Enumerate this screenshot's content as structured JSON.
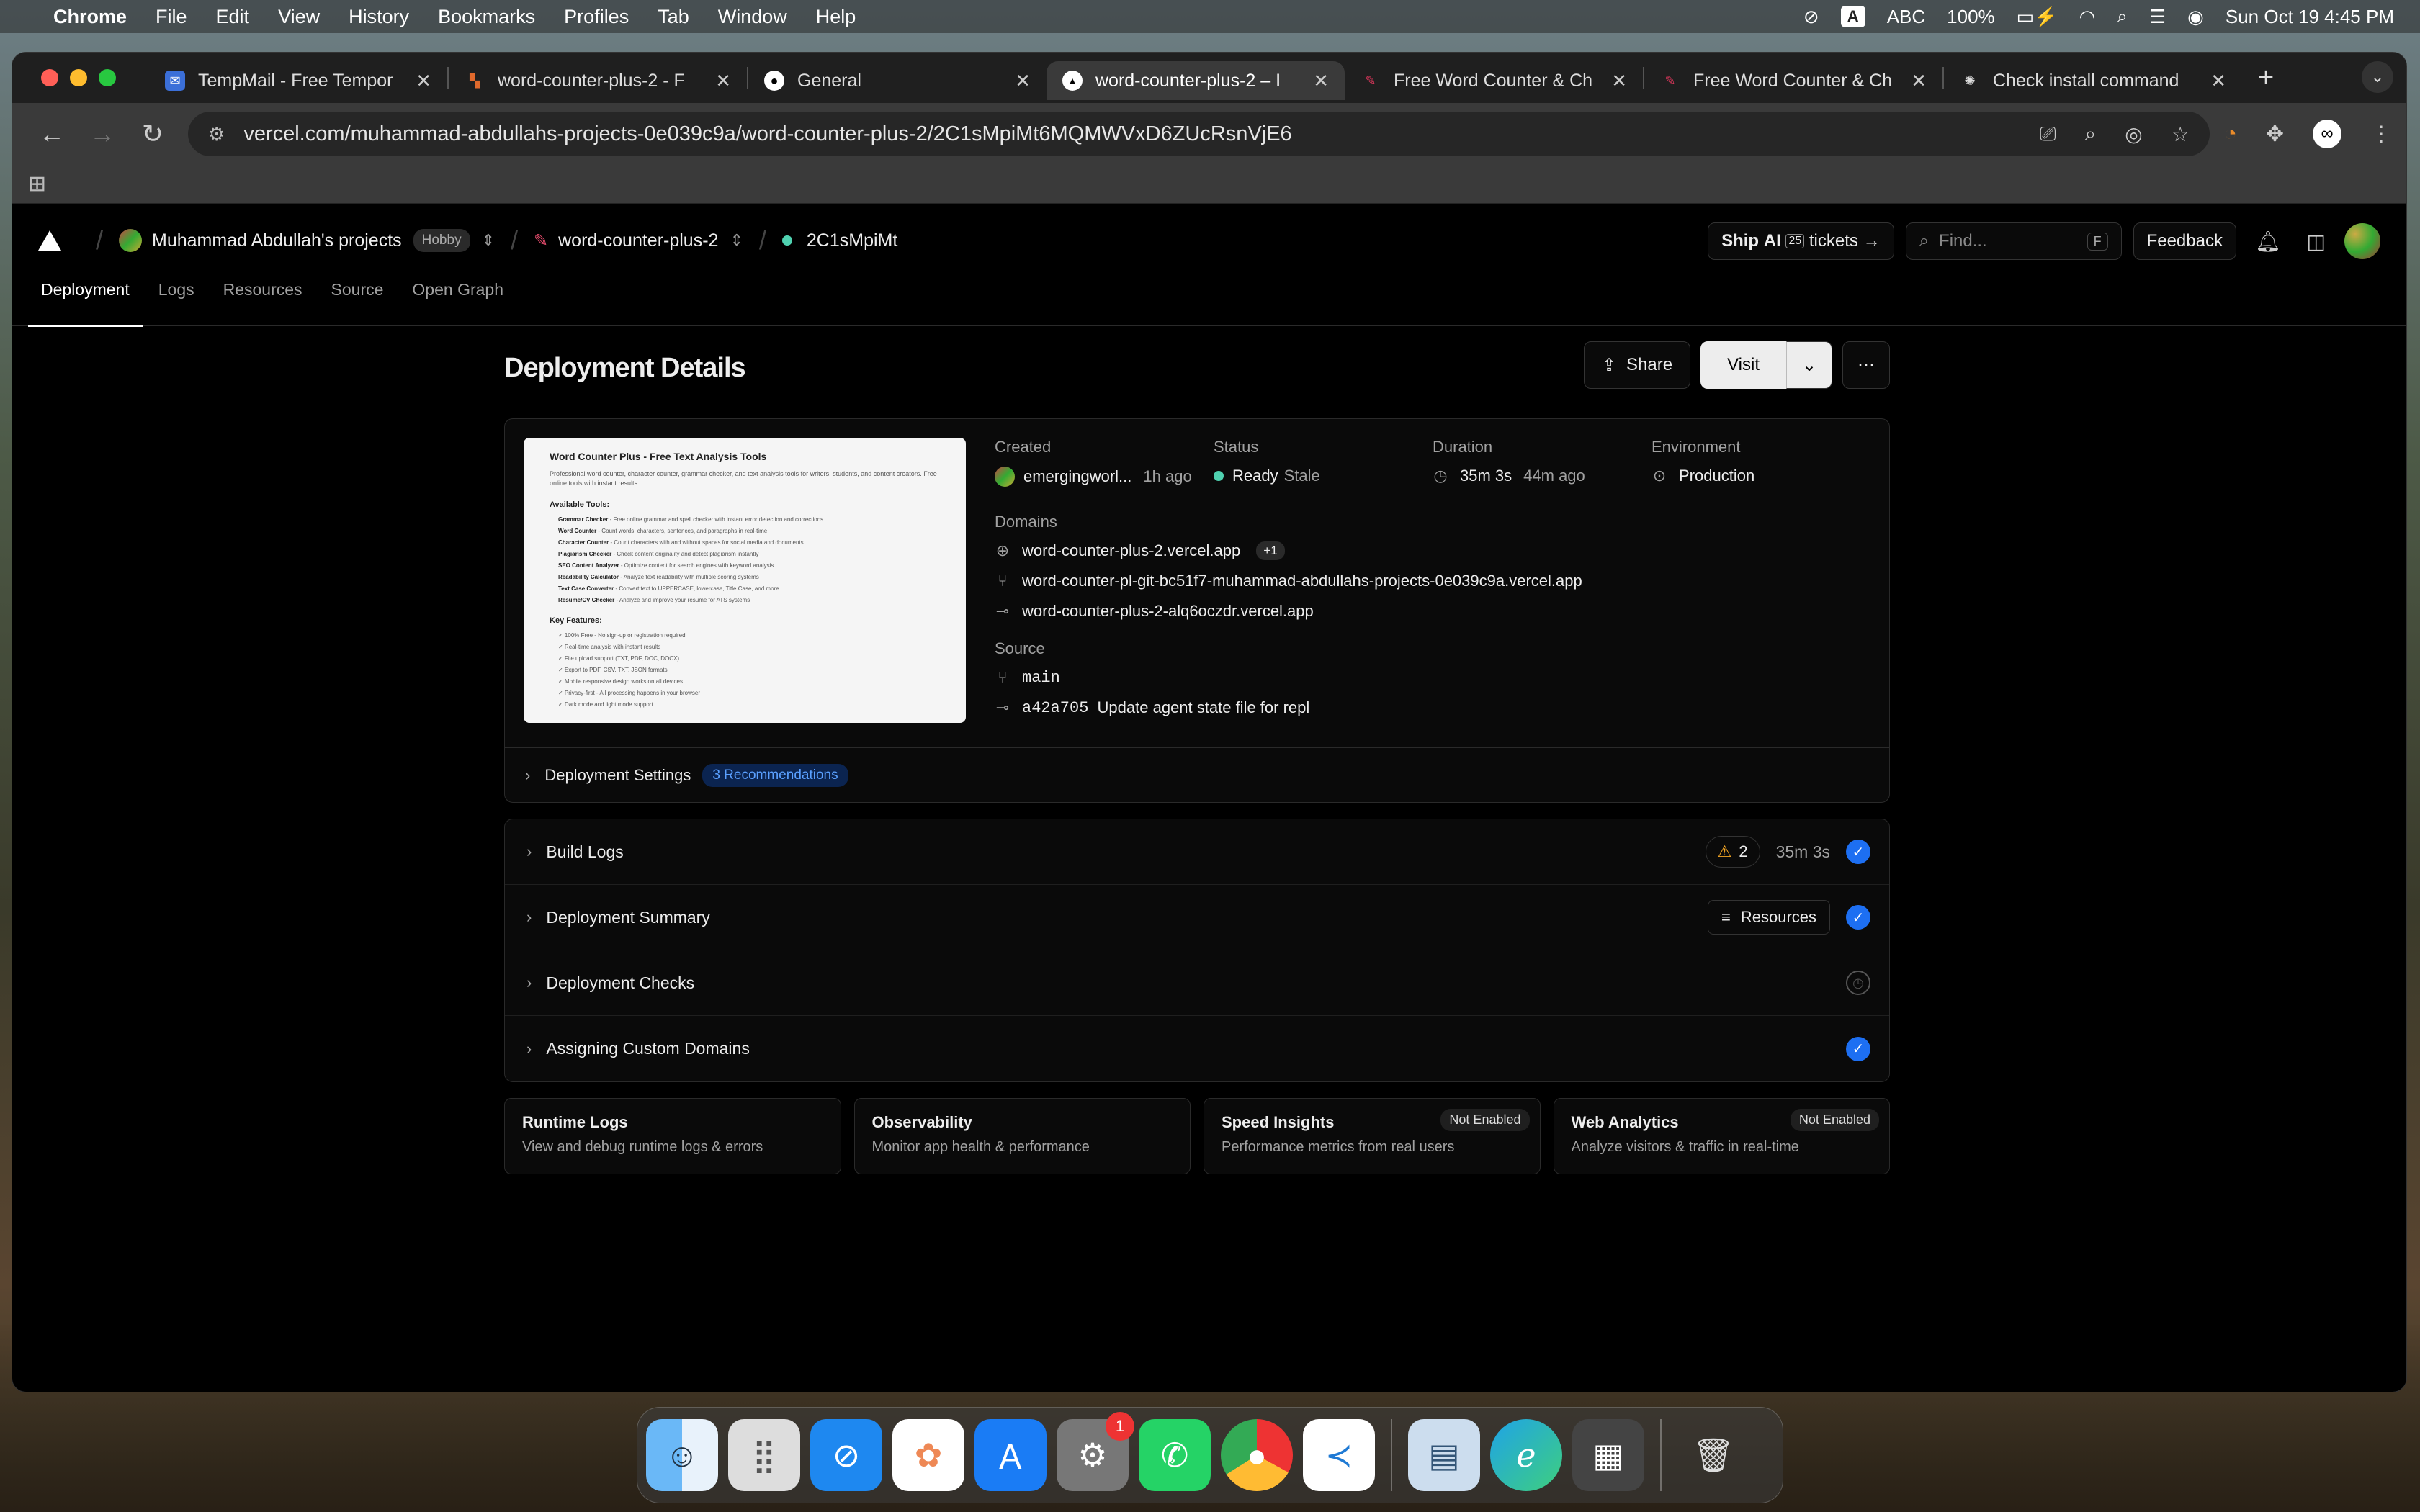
{
  "menubar": {
    "app": "Chrome",
    "items": [
      "File",
      "Edit",
      "View",
      "History",
      "Bookmarks",
      "Profiles",
      "Tab",
      "Window",
      "Help"
    ],
    "input": "ABC",
    "battery": "100%",
    "datetime": "Sun Oct 19  4:45 PM"
  },
  "tabs": [
    {
      "title": "TempMail - Free Tempor",
      "color": "#3b6fd8",
      "glyph": "✉"
    },
    {
      "title": "word-counter-plus-2 - F",
      "color": "#e0692c",
      "glyph": "▚"
    },
    {
      "title": "General",
      "color": "#222",
      "glyph": "●"
    },
    {
      "title": "word-counter-plus-2 – I",
      "color": "#000",
      "glyph": "▲"
    },
    {
      "title": "Free Word Counter & Ch",
      "color": "#d9365a",
      "glyph": "✎"
    },
    {
      "title": "Free Word Counter & Ch",
      "color": "#d9365a",
      "glyph": "✎"
    },
    {
      "title": "Check install command",
      "color": "#555",
      "glyph": "✺"
    }
  ],
  "url": "vercel.com/muhammad-abdullahs-projects-0e039c9a/word-counter-plus-2/2C1sMpiMt6MQMWVxD6ZUcRsnVjE6",
  "header": {
    "team": "Muhammad Abdullah's projects",
    "plan": "Hobby",
    "project": "word-counter-plus-2",
    "deployment": "2C1sMpiMt",
    "ship_label": "Ship",
    "ship_ai": "AI",
    "ship_num": "25",
    "ship_tickets": "tickets",
    "find_placeholder": "Find...",
    "find_key": "F",
    "feedback": "Feedback"
  },
  "nav_tabs": [
    "Deployment",
    "Logs",
    "Resources",
    "Source",
    "Open Graph"
  ],
  "page": {
    "title": "Deployment Details",
    "share": "Share",
    "visit": "Visit"
  },
  "preview": {
    "title": "Word Counter Plus - Free Text Analysis Tools",
    "desc": "Professional word counter, character counter, grammar checker, and text analysis tools for writers, students, and content creators. Free online tools with instant results.",
    "tools_heading": "Available Tools:",
    "tools": [
      [
        "Grammar Checker",
        "Free online grammar and spell checker with instant error detection and corrections"
      ],
      [
        "Word Counter",
        "Count words, characters, sentences, and paragraphs in real-time"
      ],
      [
        "Character Counter",
        "Count characters with and without spaces for social media and documents"
      ],
      [
        "Plagiarism Checker",
        "Check content originality and detect plagiarism instantly"
      ],
      [
        "SEO Content Analyzer",
        "Optimize content for search engines with keyword analysis"
      ],
      [
        "Readability Calculator",
        "Analyze text readability with multiple scoring systems"
      ],
      [
        "Text Case Converter",
        "Convert text to UPPERCASE, lowercase, Title Case, and more"
      ],
      [
        "Resume/CV Checker",
        "Analyze and improve your resume for ATS systems"
      ]
    ],
    "features_heading": "Key Features:",
    "features": [
      "✓ 100% Free - No sign-up or registration required",
      "✓ Real-time analysis with instant results",
      "✓ File upload support (TXT, PDF, DOC, DOCX)",
      "✓ Export to PDF, CSV, TXT, JSON formats",
      "✓ Mobile responsive design works on all devices",
      "✓ Privacy-first - All processing happens in your browser",
      "✓ Dark mode and light mode support"
    ]
  },
  "meta": {
    "created_label": "Created",
    "created_user": "emergingworl...",
    "created_ago": "1h ago",
    "status_label": "Status",
    "status": "Ready",
    "status_sub": "Stale",
    "duration_label": "Duration",
    "duration": "35m 3s",
    "duration_ago": "44m ago",
    "env_label": "Environment",
    "env": "Production",
    "domains_label": "Domains",
    "domains": [
      "word-counter-plus-2.vercel.app",
      "word-counter-pl-git-bc51f7-muhammad-abdullahs-projects-0e039c9a.vercel.app",
      "word-counter-plus-2-alq6oczdr.vercel.app"
    ],
    "domains_more": "+1",
    "source_label": "Source",
    "branch": "main",
    "commit_hash": "a42a705",
    "commit_msg": "Update agent state file for repl"
  },
  "settings": {
    "label": "Deployment Settings",
    "badge": "3 Recommendations"
  },
  "steps": {
    "build": "Build Logs",
    "warnings": "2",
    "build_time": "35m 3s",
    "summary": "Deployment Summary",
    "resources": "Resources",
    "checks": "Deployment Checks",
    "domains": "Assigning Custom Domains"
  },
  "cards": [
    {
      "name": "Runtime Logs",
      "desc": "View and debug runtime logs & errors",
      "badge": ""
    },
    {
      "name": "Observability",
      "desc": "Monitor app health & performance",
      "badge": ""
    },
    {
      "name": "Speed Insights",
      "desc": "Performance metrics from real users",
      "badge": "Not Enabled"
    },
    {
      "name": "Web Analytics",
      "desc": "Analyze visitors & traffic in real-time",
      "badge": "Not Enabled"
    }
  ],
  "dock": {
    "badge": "1",
    "apps": [
      "finder-icon",
      "launchpad-icon",
      "safari-icon",
      "photos-icon",
      "app-store-icon",
      "system-settings-icon",
      "whatsapp-icon",
      "chrome-icon",
      "vscode-icon",
      "preview-icon",
      "edge-icon",
      "calculator-icon",
      "trash-icon"
    ]
  }
}
